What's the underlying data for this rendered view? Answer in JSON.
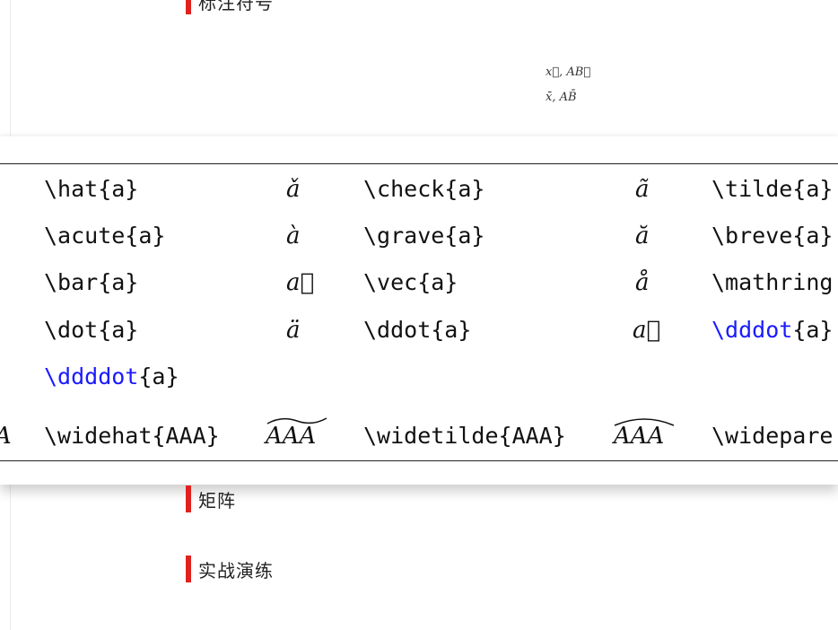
{
  "headings": {
    "top": "标注符号",
    "matrix": "矩阵",
    "practice": "实战演练"
  },
  "formulas": {
    "vec_line": "x⃗, AB⃗",
    "bar_line": "x̄, AB̄"
  },
  "table": {
    "rows": [
      {
        "c1": "\\hat{a}",
        "s1": "ǎ",
        "c2": "\\check{a}",
        "s2": "ã",
        "c3": "\\tilde{a}"
      },
      {
        "c1": "\\acute{a}",
        "s1": "à",
        "c2": "\\grave{a}",
        "s2": "ă",
        "c3": "\\breve{a}"
      },
      {
        "c1": "\\bar{a}",
        "s1": "a⃗",
        "c2": "\\vec{a}",
        "s2": "å",
        "c3": "\\mathring"
      },
      {
        "c1": "\\dot{a}",
        "s1": "ä",
        "c2": "\\ddot{a}",
        "s2": "a⃛",
        "c3_blue": "\\dddot",
        "c3_rest": "{a}"
      },
      {
        "c1_blue": "\\ddddot",
        "c1_rest": "{a}"
      },
      {
        "left_cut": "A",
        "c1": "\\widehat{AAA}",
        "s1": "AAA",
        "c2": "\\widetilde{AAA}",
        "s2": "AAA",
        "c3": "\\widepare"
      }
    ]
  }
}
